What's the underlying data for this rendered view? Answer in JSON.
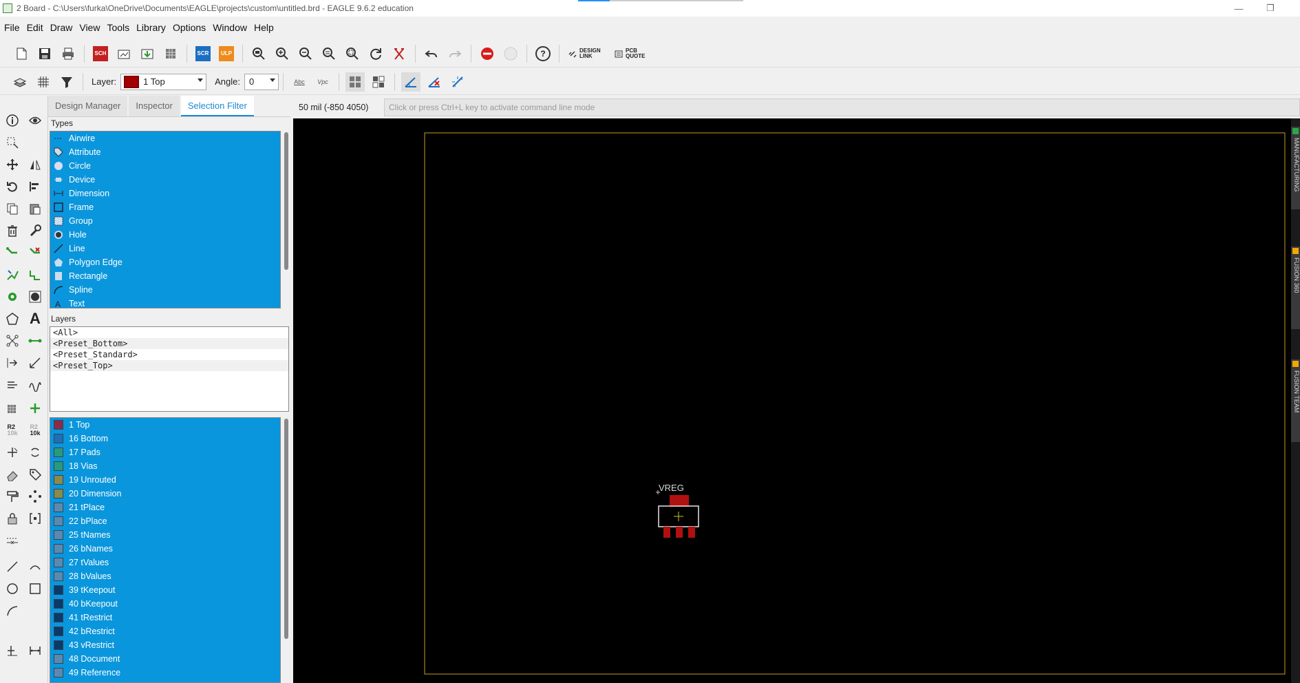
{
  "window": {
    "title": "2 Board - C:\\Users\\furka\\OneDrive\\Documents\\EAGLE\\projects\\custom\\untitled.brd - EAGLE 9.6.2 education"
  },
  "menu": [
    "File",
    "Edit",
    "Draw",
    "View",
    "Tools",
    "Library",
    "Options",
    "Window",
    "Help"
  ],
  "toolbar": {
    "sch_label": "SCH",
    "scr_label": "SCR",
    "ulp_label": "ULP",
    "help_label": "?",
    "design_link_label": "DESIGN LINK",
    "pcb_quote_label": "PCB QUOTE"
  },
  "param_bar": {
    "layer_label": "Layer:",
    "layer_value": "1 Top",
    "angle_label": "Angle:",
    "angle_value": "0",
    "abc_label": "Abc",
    "vpc_label": "Vpc"
  },
  "panel": {
    "tabs": [
      "Design Manager",
      "Inspector",
      "Selection Filter"
    ],
    "active_tab": "Selection Filter",
    "types_heading": "Types",
    "types": [
      "Airwire",
      "Attribute",
      "Circle",
      "Device",
      "Dimension",
      "Frame",
      "Group",
      "Hole",
      "Line",
      "Polygon Edge",
      "Rectangle",
      "Spline",
      "Text"
    ],
    "layers_heading": "Layers",
    "presets": [
      "<All>",
      "<Preset_Bottom>",
      "<Preset_Standard>",
      "<Preset_Top>"
    ],
    "layers": [
      {
        "name": "1 Top",
        "color": "#8c2a4a"
      },
      {
        "name": "16 Bottom",
        "color": "#1e6fb8"
      },
      {
        "name": "17 Pads",
        "color": "#2a9a7a"
      },
      {
        "name": "18 Vias",
        "color": "#2a9a7a"
      },
      {
        "name": "19 Unrouted",
        "color": "#8a8a4a"
      },
      {
        "name": "20 Dimension",
        "color": "#8a8a4a"
      },
      {
        "name": "21 tPlace",
        "color": "#5a8ab0"
      },
      {
        "name": "22 bPlace",
        "color": "#5a8ab0"
      },
      {
        "name": "25 tNames",
        "color": "#5a8ab0"
      },
      {
        "name": "26 bNames",
        "color": "#5a8ab0"
      },
      {
        "name": "27 tValues",
        "color": "#5a8ab0"
      },
      {
        "name": "28 bValues",
        "color": "#5a8ab0"
      },
      {
        "name": "39 tKeepout",
        "color": "#0a3a6a"
      },
      {
        "name": "40 bKeepout",
        "color": "#0a3a6a"
      },
      {
        "name": "41 tRestrict",
        "color": "#0a3a6a"
      },
      {
        "name": "42 bRestrict",
        "color": "#0a3a6a"
      },
      {
        "name": "43 vRestrict",
        "color": "#0a3a6a"
      },
      {
        "name": "48 Document",
        "color": "#5a8ab0"
      },
      {
        "name": "49 Reference",
        "color": "#5a8ab0"
      }
    ]
  },
  "status": {
    "coordinate": "50 mil (-850 4050)",
    "command_placeholder": "Click or press Ctrl+L key to activate command line mode"
  },
  "canvas": {
    "component_label": "VREG",
    "outline_color": "#c8a020",
    "pad_color": "#b01010"
  },
  "right_dock": [
    "MANUFACTURING",
    "FUSION 360",
    "FUSION TEAM"
  ]
}
